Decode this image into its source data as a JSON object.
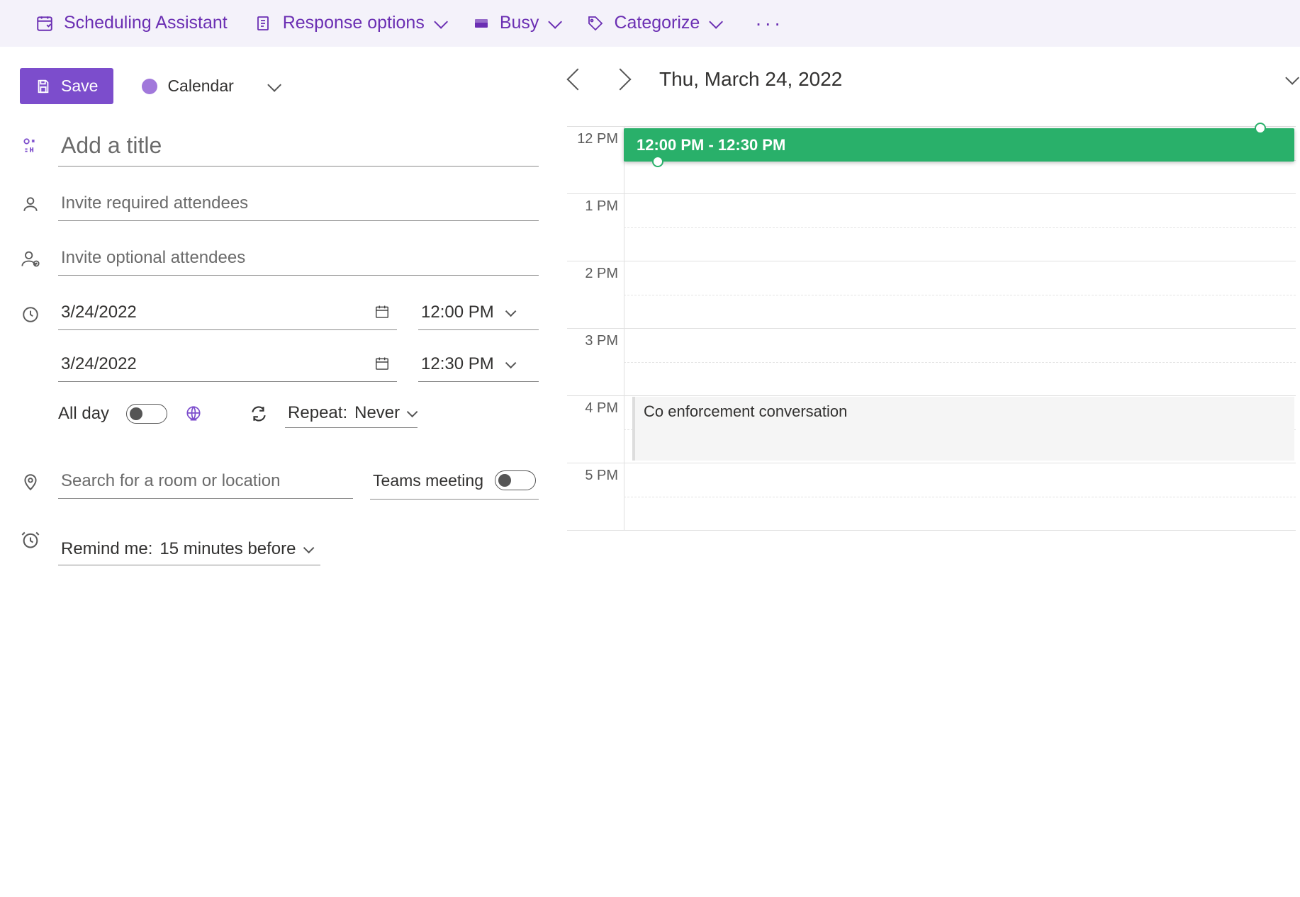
{
  "toolbar": {
    "scheduling_assistant": "Scheduling Assistant",
    "response_options": "Response options",
    "busy": "Busy",
    "categorize": "Categorize"
  },
  "save_button": "Save",
  "calendar_picker": {
    "label": "Calendar"
  },
  "title": {
    "placeholder": "Add a title"
  },
  "attendees": {
    "required_placeholder": "Invite required attendees",
    "optional_placeholder": "Invite optional attendees"
  },
  "datetime": {
    "start_date": "3/24/2022",
    "start_time": "12:00 PM",
    "end_date": "3/24/2022",
    "end_time": "12:30 PM",
    "all_day_label": "All day",
    "repeat_label": "Repeat:",
    "repeat_value": "Never"
  },
  "location": {
    "placeholder": "Search for a room or location",
    "teams_label": "Teams meeting"
  },
  "reminder": {
    "label": "Remind me:",
    "value": "15 minutes before"
  },
  "day_view": {
    "date_label": "Thu, March 24, 2022",
    "hours": [
      "12 PM",
      "1 PM",
      "2 PM",
      "3 PM",
      "4 PM",
      "5 PM"
    ],
    "new_event_label": "12:00 PM - 12:30 PM",
    "existing_event": "Co enforcement conversation"
  }
}
